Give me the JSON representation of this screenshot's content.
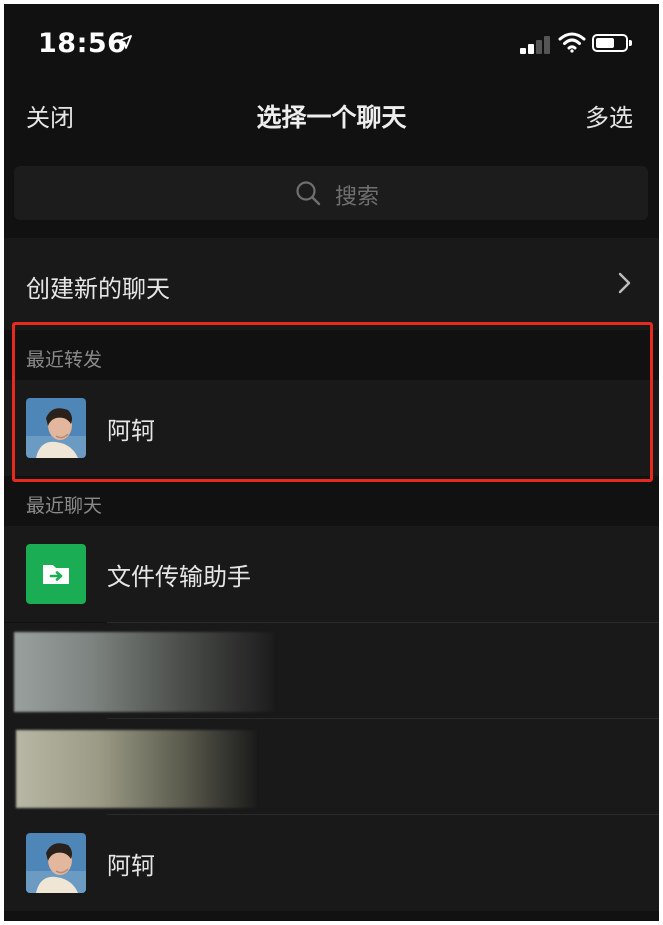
{
  "status_bar": {
    "time": "18:56",
    "icons": [
      "location-arrow-icon",
      "cellular-signal-icon",
      "wifi-icon",
      "battery-icon"
    ]
  },
  "nav": {
    "left": "关闭",
    "title": "选择一个聊天",
    "right": "多选"
  },
  "search": {
    "placeholder": "搜索"
  },
  "create_chat": {
    "label": "创建新的聊天"
  },
  "recent_forward": {
    "header": "最近转发",
    "items": [
      {
        "name": "阿轲"
      }
    ]
  },
  "recent_chats": {
    "header": "最近聊天",
    "items": [
      {
        "name": "文件传输助手",
        "icon": "file-transfer-icon"
      },
      {
        "name": ""
      },
      {
        "name": ""
      },
      {
        "name": "阿轲"
      }
    ]
  },
  "colors": {
    "background": "#111111",
    "row": "#191919",
    "highlight": "#e8291e",
    "file_transfer_green": "#1aad54"
  }
}
